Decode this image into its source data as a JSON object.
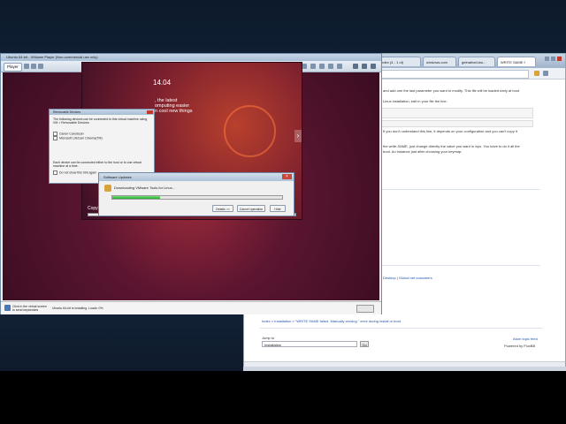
{
  "vm": {
    "title": "Ubuntu 64-bit - VMware Player (Non-commercial use only)",
    "player_label": "Player",
    "screen": {
      "ubuntu_version": "14.04",
      "slide_lines": [
        ", the latest",
        "omputing easier",
        "n cool new things"
      ],
      "installer_status": "Copying files...",
      "installer_progress": 0.97
    },
    "hint_text": "Click in the virtual screen to send keystrokes",
    "hint_status": "Ubuntu 64-bit is installing. Loads: 0%"
  },
  "removable_devices": {
    "title": "Removable Devices",
    "intro": "The following devices can be connected to this virtual machine using VM > Removable Devices:",
    "devices": [
      "Canon CanoScan",
      "Microsoft LifeCam Cinema(TM)"
    ],
    "footer": "Each device can be connected either to the host or to one virtual machine at a time.",
    "dont_show": "Do not show this hint again"
  },
  "software_updates": {
    "title": "Software Updates",
    "message": "Downloading VMware Tools for Linux...",
    "progress": 0.28,
    "buttons": [
      "Details >>",
      "Cancel operation",
      "Hide"
    ]
  },
  "browser": {
    "tabs": [
      "Index (4 - 1 of)",
      "windows.com",
      "getnative/ubu...",
      "WRITE SAME f"
    ],
    "page": {
      "line1": "and add one the last parameter you want to modify. This file will be loaded early at boot",
      "line2": "Linux installation, edit in your file the line:",
      "line3": "If you don't understand this line, it depends on your configuration and you can't copy it",
      "line4": "the write-SAME, just change directly the value you want in /sys. You have to do it all the",
      "line5": "boot. An instance just after choosing your keymap.",
      "footer_links": "Desktop | Global net customers",
      "breadcrumb": "Index » Installation » \"WRITE SAME failed. Manually zeroing.\" error during install or boot",
      "jump_label": "Jump to",
      "jump_select": "Installation",
      "go_label": "Go",
      "atom_link": "Atom topic feed",
      "powered_by": "Powered by FluxBB"
    }
  }
}
